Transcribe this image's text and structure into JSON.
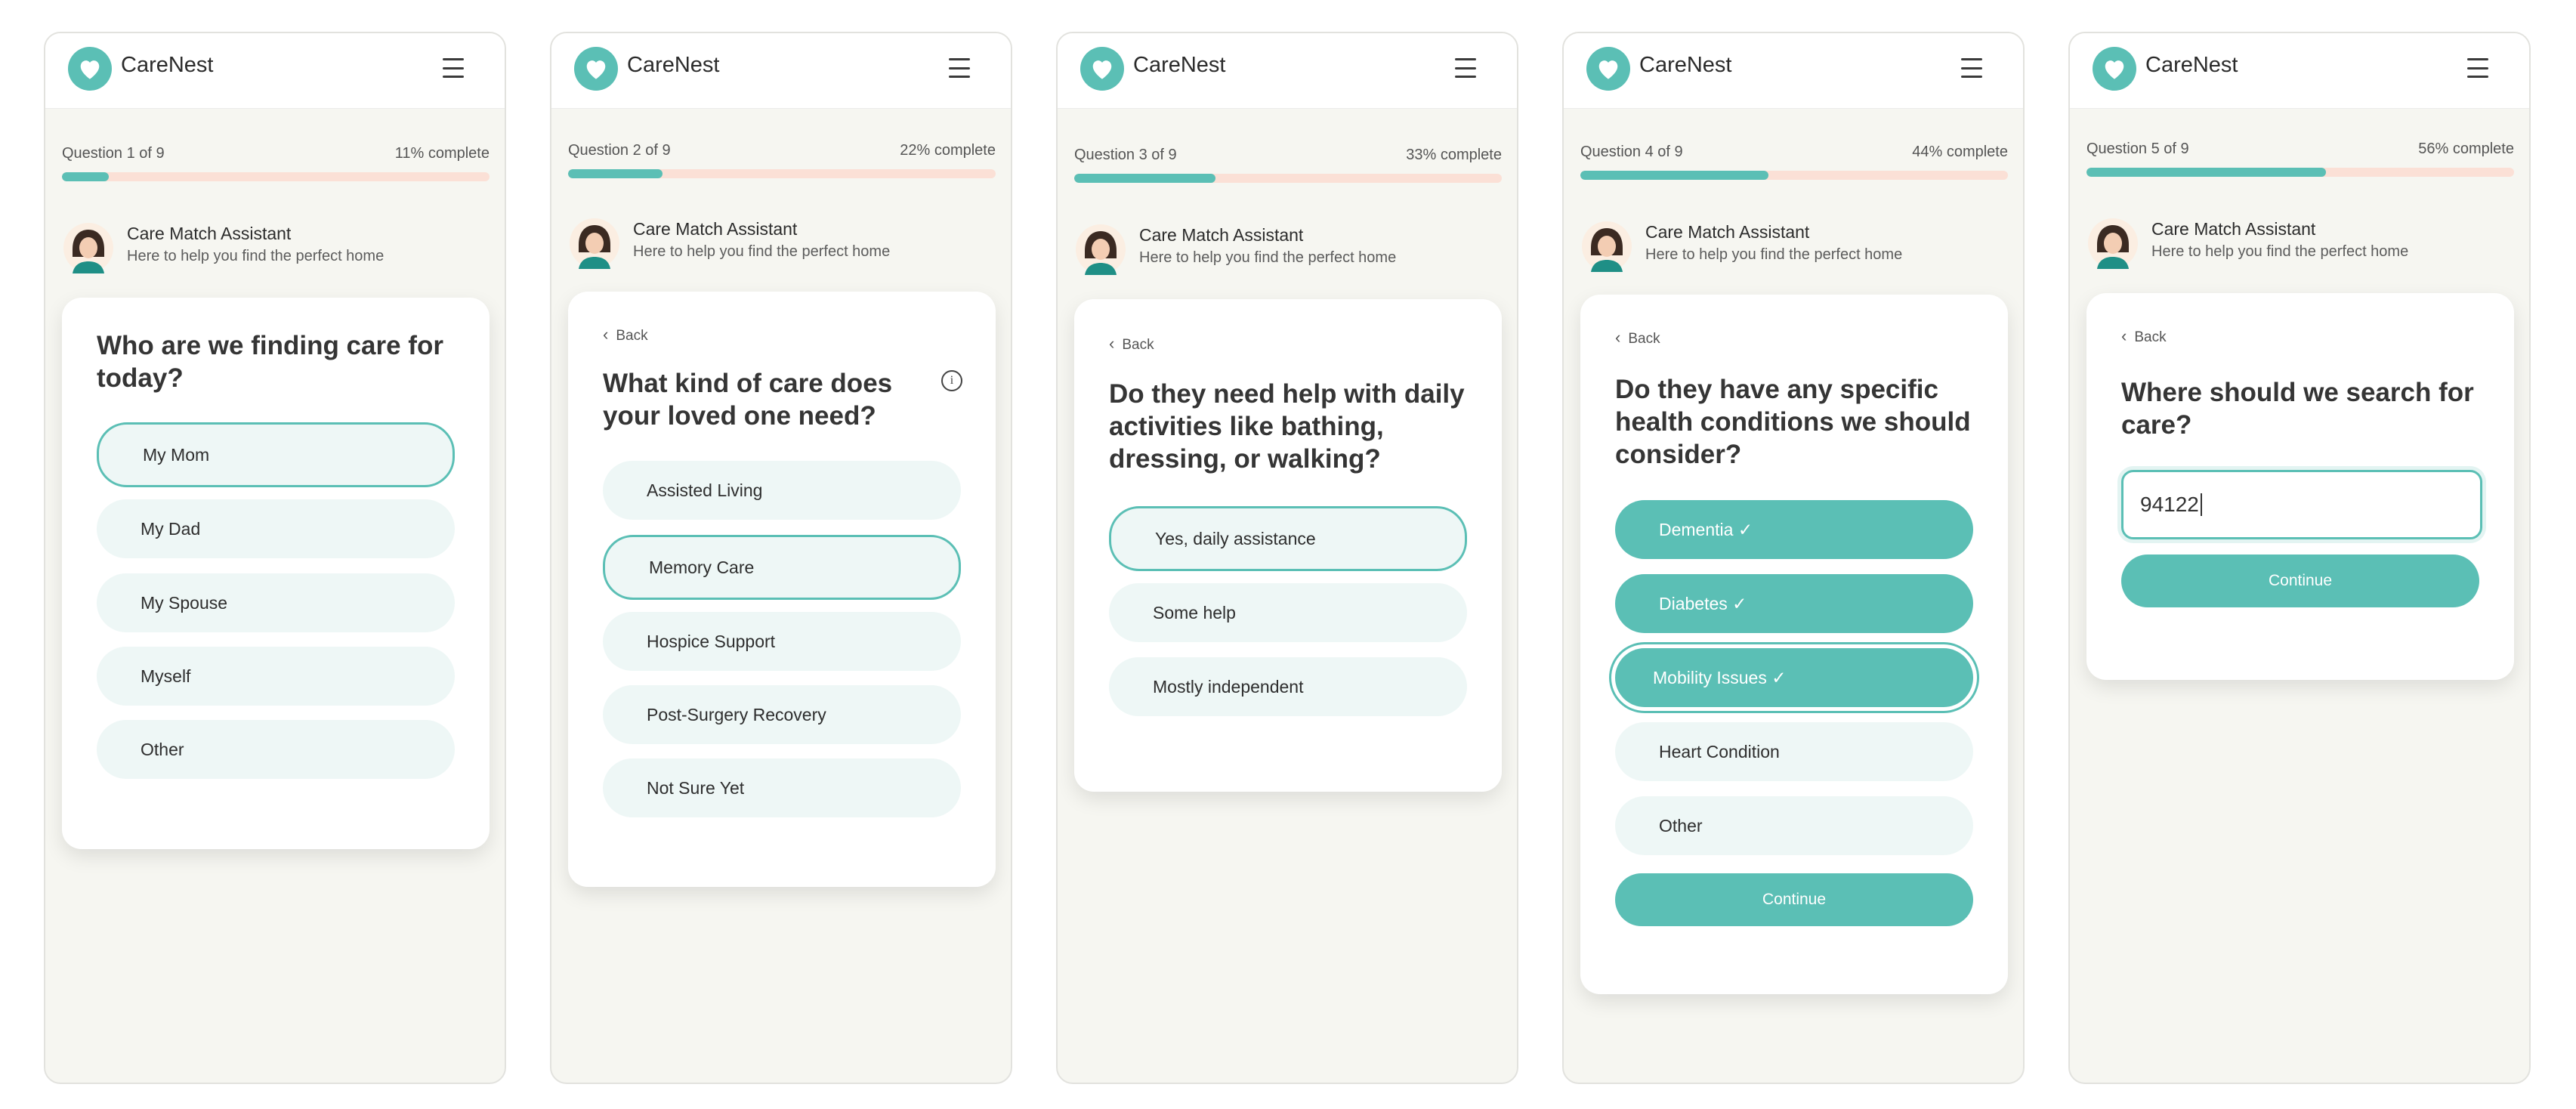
{
  "brand": "CareNest",
  "assistant": {
    "name": "Care Match Assistant",
    "subtitle": "Here to help you find the perfect home"
  },
  "back_label": "Back",
  "colors": {
    "accent": "#5bbfb5",
    "progress_track": "#fbe0d6",
    "option_bg": "#eef7f6",
    "page_bg": "#f6f6f1"
  },
  "screens": [
    {
      "question_label": "Question 1 of 9",
      "percent_label": "11% complete",
      "progress": 0.11,
      "title": "Who are we finding care for today?",
      "options": [
        {
          "label": "My Mom",
          "state": "selected"
        },
        {
          "label": "My Dad",
          "state": "default"
        },
        {
          "label": "My Spouse",
          "state": "default"
        },
        {
          "label": "Myself",
          "state": "default"
        },
        {
          "label": "Other",
          "state": "default"
        }
      ]
    },
    {
      "question_label": "Question 2 of 9",
      "percent_label": "22% complete",
      "progress": 0.22,
      "title": "What kind of care does your loved one need?",
      "info_icon": "i",
      "options": [
        {
          "label": "Assisted Living",
          "state": "default"
        },
        {
          "label": "Memory Care",
          "state": "selected"
        },
        {
          "label": "Hospice Support",
          "state": "default"
        },
        {
          "label": "Post-Surgery Recovery",
          "state": "default"
        },
        {
          "label": "Not Sure Yet",
          "state": "default"
        }
      ]
    },
    {
      "question_label": "Question 3 of 9",
      "percent_label": "33% complete",
      "progress": 0.33,
      "title": "Do they need help with daily activities like bathing, dressing, or walking?",
      "options": [
        {
          "label": "Yes, daily assistance",
          "state": "selected"
        },
        {
          "label": "Some help",
          "state": "default"
        },
        {
          "label": "Mostly independent",
          "state": "default"
        }
      ]
    },
    {
      "question_label": "Question 4 of 9",
      "percent_label": "44% complete",
      "progress": 0.44,
      "title": "Do they have any specific health conditions we should consider?",
      "options": [
        {
          "label": "Dementia ✓",
          "state": "checked"
        },
        {
          "label": "Diabetes ✓",
          "state": "checked"
        },
        {
          "label": "Mobility Issues ✓",
          "state": "checked-focused"
        },
        {
          "label": "Heart Condition",
          "state": "default"
        },
        {
          "label": "Other",
          "state": "default"
        }
      ],
      "continue_label": "Continue"
    },
    {
      "question_label": "Question 5 of 9",
      "percent_label": "56% complete",
      "progress": 0.56,
      "title": "Where should we search for care?",
      "zip_value": "94122",
      "continue_label": "Continue"
    }
  ]
}
